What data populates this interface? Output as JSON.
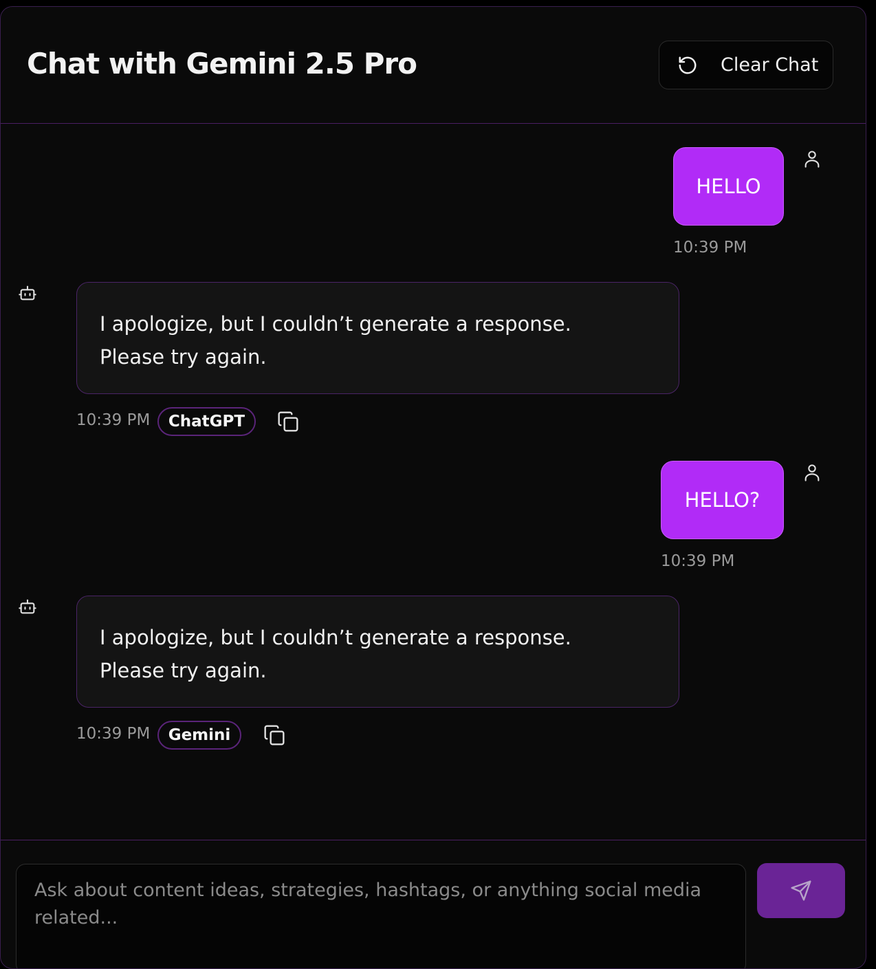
{
  "header": {
    "title": "Chat with Gemini 2.5 Pro",
    "clear_label": "Clear Chat",
    "clear_icon": "refresh-icon"
  },
  "messages": [
    {
      "role": "user",
      "text": "HELLO",
      "time": "10:39 PM"
    },
    {
      "role": "assistant",
      "line1": "I apologize, but I couldn’t generate a response.",
      "line2": "Please try again.",
      "time": "10:39 PM",
      "model": "ChatGPT"
    },
    {
      "role": "user",
      "text": "HELLO?",
      "time": "10:39 PM"
    },
    {
      "role": "assistant",
      "line1": "I apologize, but I couldn’t generate a response.",
      "line2": "Please try again.",
      "time": "10:39 PM",
      "model": "Gemini"
    }
  ],
  "composer": {
    "placeholder": "Ask about content ideas, strategies, hashtags, or anything social media related...",
    "send_icon": "send-icon"
  },
  "colors": {
    "accent": "#b12bf7",
    "send_button": "#6a2496",
    "border": "#4a1f63"
  }
}
